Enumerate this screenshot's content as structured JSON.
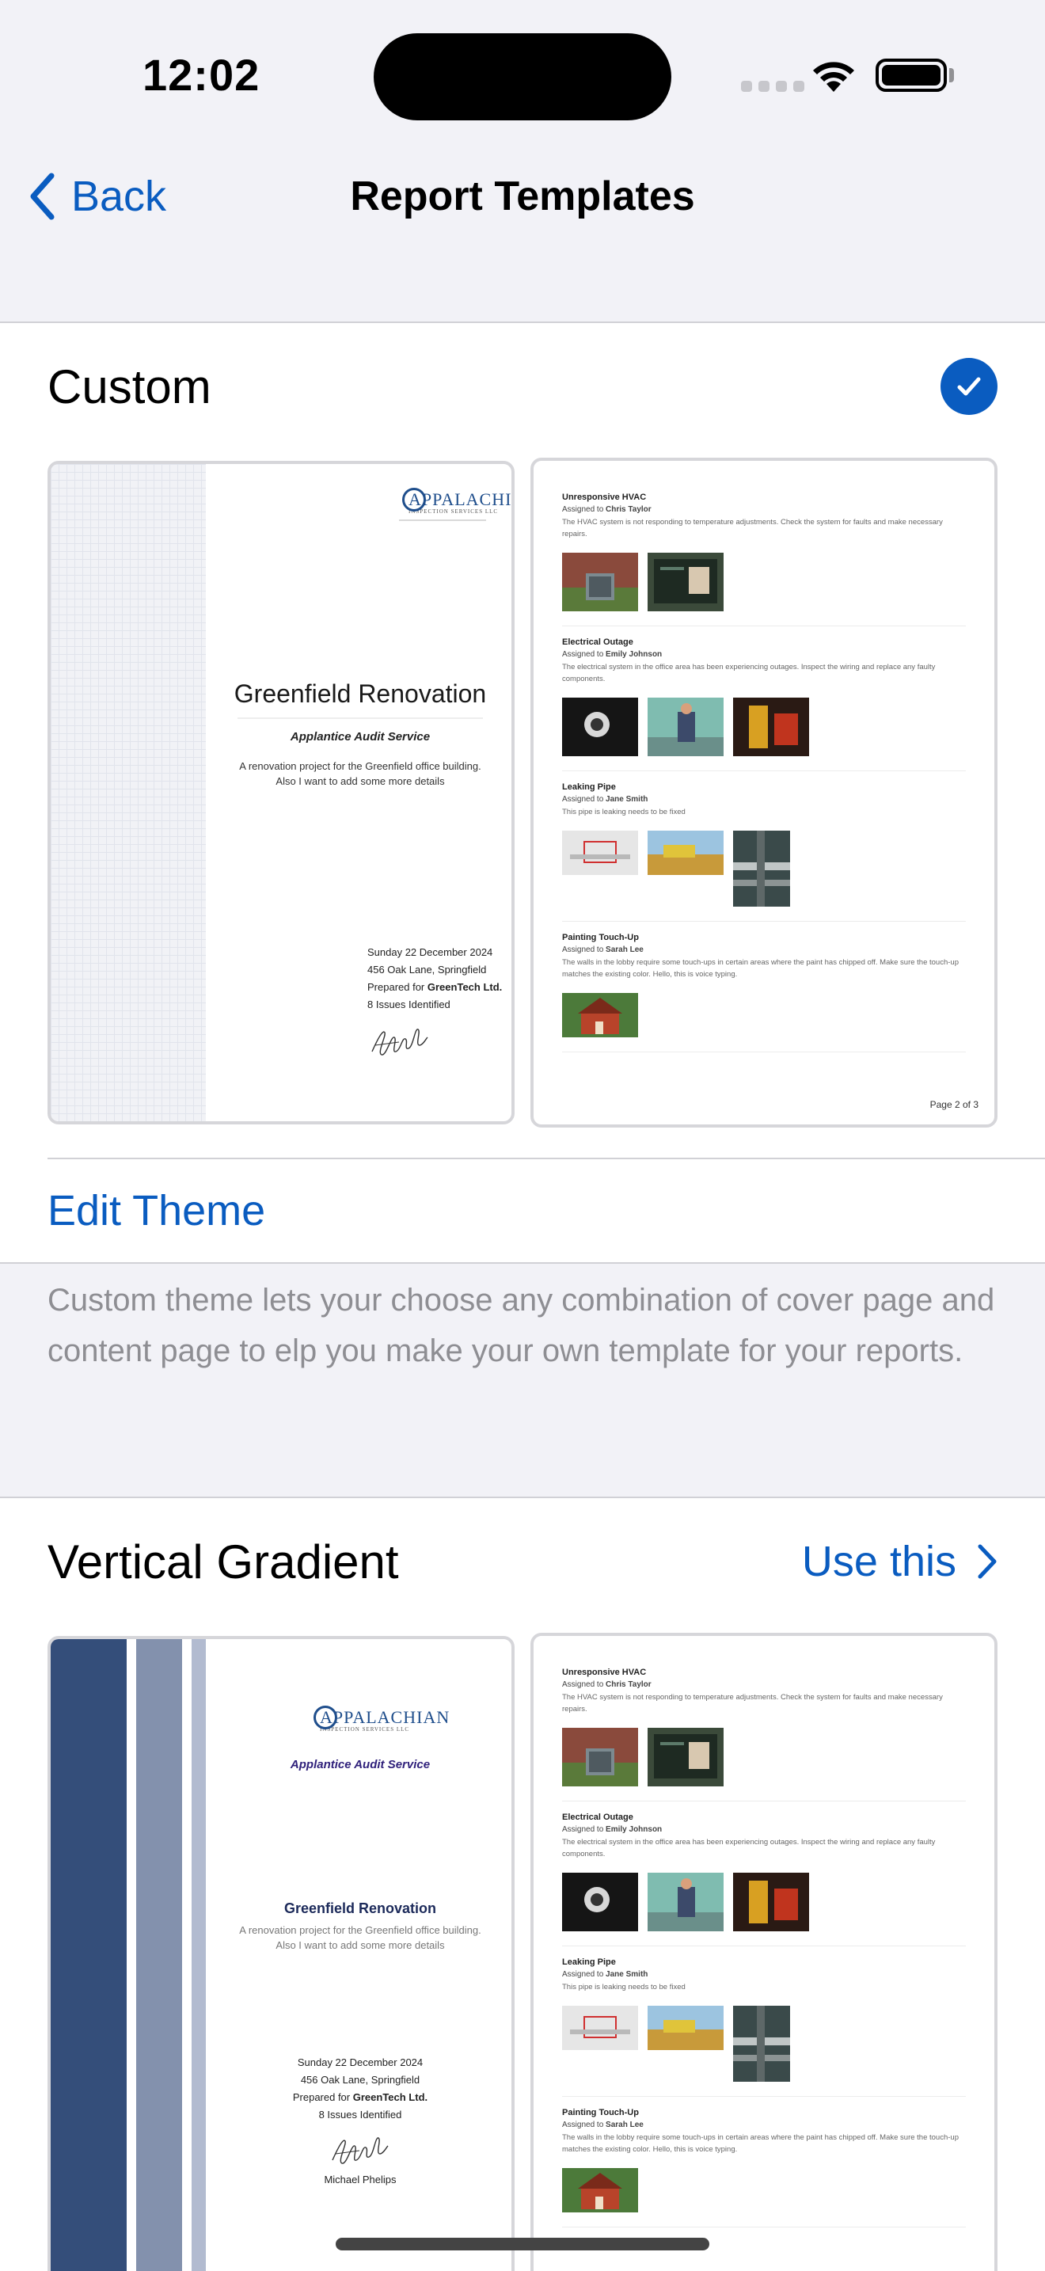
{
  "status_bar": {
    "time": "12:02"
  },
  "nav": {
    "back_label": "Back",
    "title": "Report Templates"
  },
  "custom_card": {
    "title": "Custom",
    "selected": true,
    "edit_label": "Edit Theme",
    "description": "Custom theme lets your choose any combination of cover page and content page to elp you make your own template for your reports."
  },
  "gradient_card": {
    "title": "Vertical Gradient",
    "action_label": "Use this",
    "bar_colors": [
      "#344e7a",
      "#8391ad",
      "#b2bbd0"
    ]
  },
  "cover": {
    "logo_big": "APPALACHIAN",
    "logo_small": "INSPECTION SERVICES LLC",
    "project_title": "Greenfield Renovation",
    "service": "Applantice Audit Service",
    "description": "A renovation project for the Greenfield office building. Also I want to add some more details",
    "date": "Sunday 22 December 2024",
    "address": "456 Oak Lane, Springfield",
    "prepared_for_prefix": "Prepared for",
    "prepared_for_company": "GreenTech Ltd.",
    "issues": "8 Issues Identified",
    "signer": "Michael Phelips"
  },
  "content_page": {
    "assigned_prefix": "Assigned to",
    "issues": [
      {
        "title": "Unresponsive HVAC",
        "assignee": "Chris Taylor",
        "desc": "The HVAC system is not responding to temperature adjustments. Check the system for faults and make necessary repairs."
      },
      {
        "title": "Electrical Outage",
        "assignee": "Emily Johnson",
        "desc": "The electrical system in the office area has been experiencing outages. Inspect the wiring and replace any faulty components."
      },
      {
        "title": "Leaking Pipe",
        "assignee": "Jane Smith",
        "desc": "This pipe is leaking needs to be fixed"
      },
      {
        "title": "Painting Touch-Up",
        "assignee": "Sarah Lee",
        "desc": "The walls in the lobby require some touch-ups in certain areas where the paint has chipped off. Make sure the touch-up matches the existing color. Hello, this is voice typing."
      }
    ],
    "page_label": "Page 2 of 3"
  },
  "colors": {
    "accent": "#0a5cc0",
    "background": "#f2f2f7",
    "secondary_text": "#8e8e93"
  }
}
